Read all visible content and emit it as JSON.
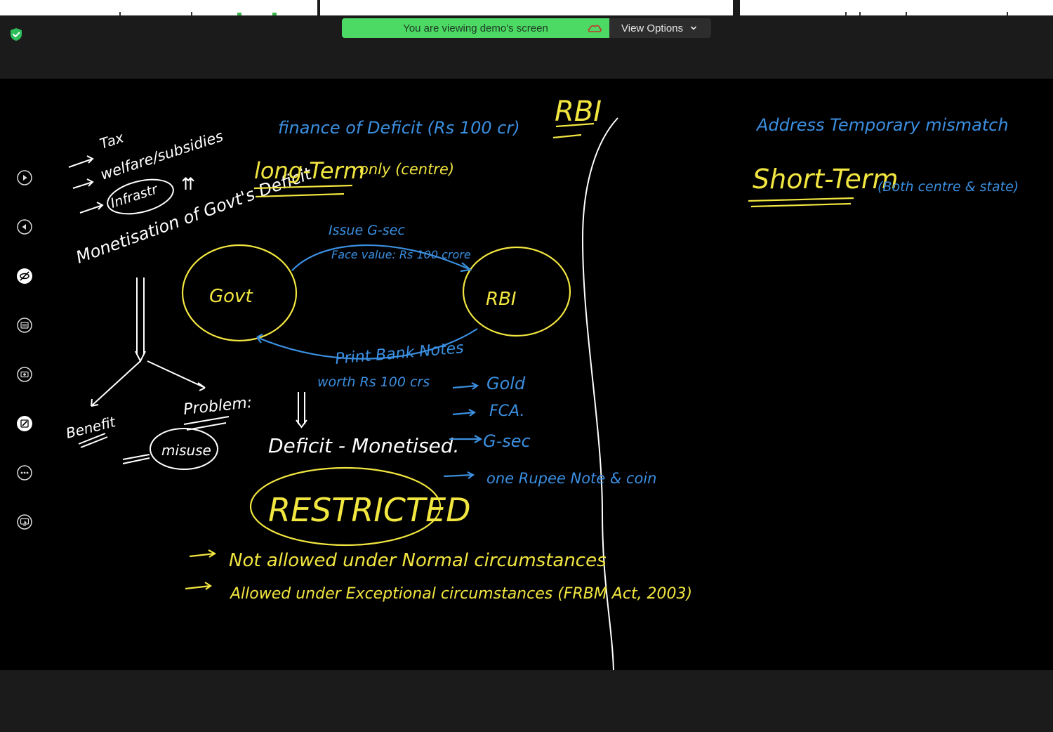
{
  "banner": {
    "viewing_text": "You are viewing demo's screen"
  },
  "view_options": {
    "label": "View Options"
  },
  "colors": {
    "banner_green": "#4cd964",
    "ink_white": "#ffffff",
    "ink_yellow": "#f2e640",
    "ink_blue": "#3b8fe0",
    "board_bg": "#000000"
  },
  "sidebar_tools": [
    "play-icon",
    "rewind-icon",
    "hide-annotation-icon",
    "captions-icon",
    "record-icon",
    "annotate-icon",
    "more-icon",
    "remote-control-icon"
  ],
  "whiteboard": {
    "left_list": [
      "Tax",
      "welfare/subsidies",
      "Infrastr"
    ],
    "monetisation": "Monetisation of Govt's Deficit",
    "benefit": "Benefit",
    "problem": "Problem:",
    "misuse": "misuse",
    "finance_title": "finance of Deficit (Rs 100 cr)",
    "long_term": "long-Term",
    "only_centre": "only (centre)",
    "govt": "Govt",
    "rbi_circle": "RBI",
    "issue_gsec": "Issue G-sec",
    "face_value": "Face value: Rs 100 crore",
    "print_bank_notes": "Print Bank Notes",
    "worth": "worth Rs 100 crs",
    "deficit_monetised": "Deficit - Monetised.",
    "restricted": "RESTRICTED",
    "not_allowed": "Not allowed under Normal circumstances",
    "allowed": "Allowed under Exceptional circumstances (FRBM Act, 2003)",
    "rbi_assets": [
      "Gold",
      "FCA.",
      "G-sec",
      "one Rupee Note & coin"
    ],
    "rbi_heading": "RBI",
    "address": "Address Temporary mismatch",
    "short_term": "Short-Term",
    "short_term_note": "(Both centre & state)"
  }
}
